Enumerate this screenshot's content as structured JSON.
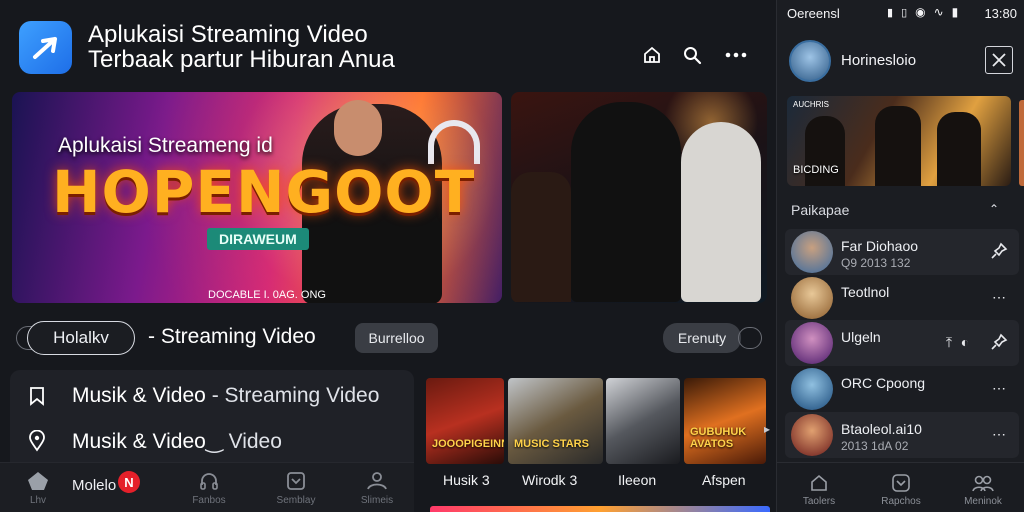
{
  "header": {
    "title_line1": "Aplukaisi Streaming Video",
    "title_line2": "Terbaak partur Hiburan Anua",
    "icons": [
      "home-icon",
      "search-icon",
      "more-icon"
    ]
  },
  "hero": {
    "subtitle": "Aplukaisi Streameng id",
    "headline": "HOPENGOOT",
    "badge": "DIRAWEUM",
    "footer": "DOCABLE I. 0AG. ONG"
  },
  "tabs": {
    "chip_selected": "Holalkv",
    "stream_label": "- Streaming Video",
    "chip_mid": "Burrelloo",
    "chip_right": "Erenuty"
  },
  "list": [
    {
      "icon": "bookmark-icon",
      "bold": "Musik & Video",
      "rest": " - Streaming Video"
    },
    {
      "icon": "location-pin-icon",
      "bold": "Musik & Video",
      "rest": "‿ Video"
    }
  ],
  "bottom_nav": {
    "home_label": "Molelo",
    "badge": "N",
    "items": [
      {
        "icon": "home-icon",
        "label": "Lhv"
      },
      {
        "icon": "headphones-icon",
        "label": "Fanbos"
      },
      {
        "icon": "checkbox-icon",
        "label": "Semblay"
      },
      {
        "icon": "user-icon",
        "label": "Slimeis"
      }
    ]
  },
  "thumbs": [
    {
      "title": "JOOOPIGEINNE",
      "caption": "Husik 3"
    },
    {
      "title": "MUSIC STARS",
      "caption": "Wirodk 3"
    },
    {
      "title": "",
      "caption": "Ileeon"
    },
    {
      "title": "GUBUHUK AVATOS",
      "caption": "Afspen"
    }
  ],
  "status": {
    "left": "Oereensl",
    "time": "13:80"
  },
  "side": {
    "username": "Horinesloio",
    "video_caption": "BICDING",
    "video_top": "AUCHRIS",
    "section_title": "Paikapae",
    "section_ctrl": "⌃",
    "tracks": [
      {
        "name": "Far Diohaoo",
        "meta": "Q9 2013 132",
        "action": "pin",
        "highlight": true,
        "color": "#3a6aa0"
      },
      {
        "name": "Teotlnol",
        "meta": "",
        "action": "more",
        "highlight": false,
        "color": "#c49a5a"
      },
      {
        "name": "Ulgeln",
        "meta": "",
        "action": "share",
        "highlight": true,
        "color": "#7a2a8a"
      },
      {
        "name": "ORC Cpoong",
        "meta": "",
        "action": "more",
        "highlight": false,
        "color": "#2a6a9a"
      },
      {
        "name": "Btaoleol.ai10",
        "meta": "2013 1dA 02",
        "action": "more",
        "highlight": true,
        "color": "#8a3a2a"
      }
    ],
    "nav": [
      {
        "icon": "home-icon",
        "label": "Taolers"
      },
      {
        "icon": "download-icon",
        "label": "Rapchos"
      },
      {
        "icon": "group-icon",
        "label": "Meninok"
      }
    ]
  }
}
